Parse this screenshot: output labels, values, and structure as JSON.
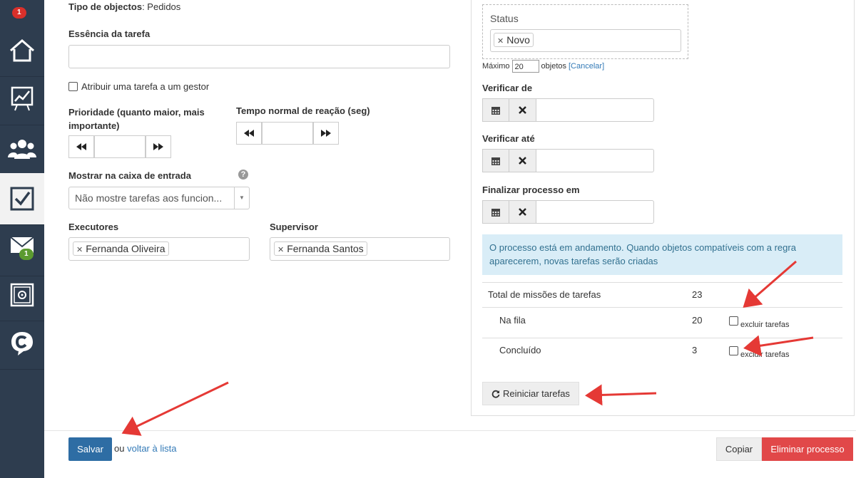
{
  "sidebar": {
    "top_badge": "1",
    "mail_badge": "1",
    "items": [
      {
        "icon": "home-icon"
      },
      {
        "icon": "chart-icon"
      },
      {
        "icon": "users-icon"
      },
      {
        "icon": "tasks-checkbox-icon"
      },
      {
        "icon": "mail-icon"
      },
      {
        "icon": "safe-icon"
      },
      {
        "icon": "chat-c-icon"
      }
    ]
  },
  "form": {
    "object_type_label": "Tipo de objectos",
    "object_type_value": "Pedidos",
    "task_essence_label": "Essência da tarefa",
    "task_essence_value": "",
    "assign_manager_label": "Atribuir uma tarefa a um gestor",
    "priority_label_line1": "Prioridade (quanto maior, mais",
    "priority_label_line2": "importante)",
    "priority_value": "",
    "reaction_time_label": "Tempo normal de reação (seg)",
    "reaction_time_value": "",
    "inbox_label": "Mostrar na caixa de entrada",
    "inbox_select_value": "Não mostre tarefas aos funcion...",
    "executors_label": "Executores",
    "executor_tag": "Fernanda Oliveira",
    "supervisor_label": "Supervisor",
    "supervisor_tag": "Fernanda Santos"
  },
  "right": {
    "status_label": "Status",
    "status_tag": "Novo",
    "max_label": "Máximo",
    "max_value": "20",
    "objects_label": "objetos",
    "cancel_link": "[Cancelar]",
    "verify_from_label": "Verificar de",
    "verify_until_label": "Verificar até",
    "finish_label": "Finalizar processo em",
    "info_line1": "O processo está em andamento. Quando objetos compatíveis com a regra",
    "info_line2": "aparecerem, novas tarefas serão criadas",
    "stats": {
      "total_label": "Total de missões de tarefas",
      "total_value": "23",
      "queue_label": "Na fila",
      "queue_value": "20",
      "done_label": "Concluído",
      "done_value": "3",
      "exclude_label": "excluir tarefas"
    },
    "restart_button": "Reiniciar tarefas"
  },
  "footer": {
    "save_button": "Salvar",
    "or_text": "ou",
    "back_link": "voltar à lista",
    "copy_button": "Copiar",
    "delete_button": "Eliminar processo"
  },
  "colors": {
    "sidebar_bg": "#2e3d4f",
    "primary": "#2e6da4",
    "danger": "#e14849",
    "info_bg": "#d9edf7",
    "annotation_arrow": "#e53935"
  }
}
